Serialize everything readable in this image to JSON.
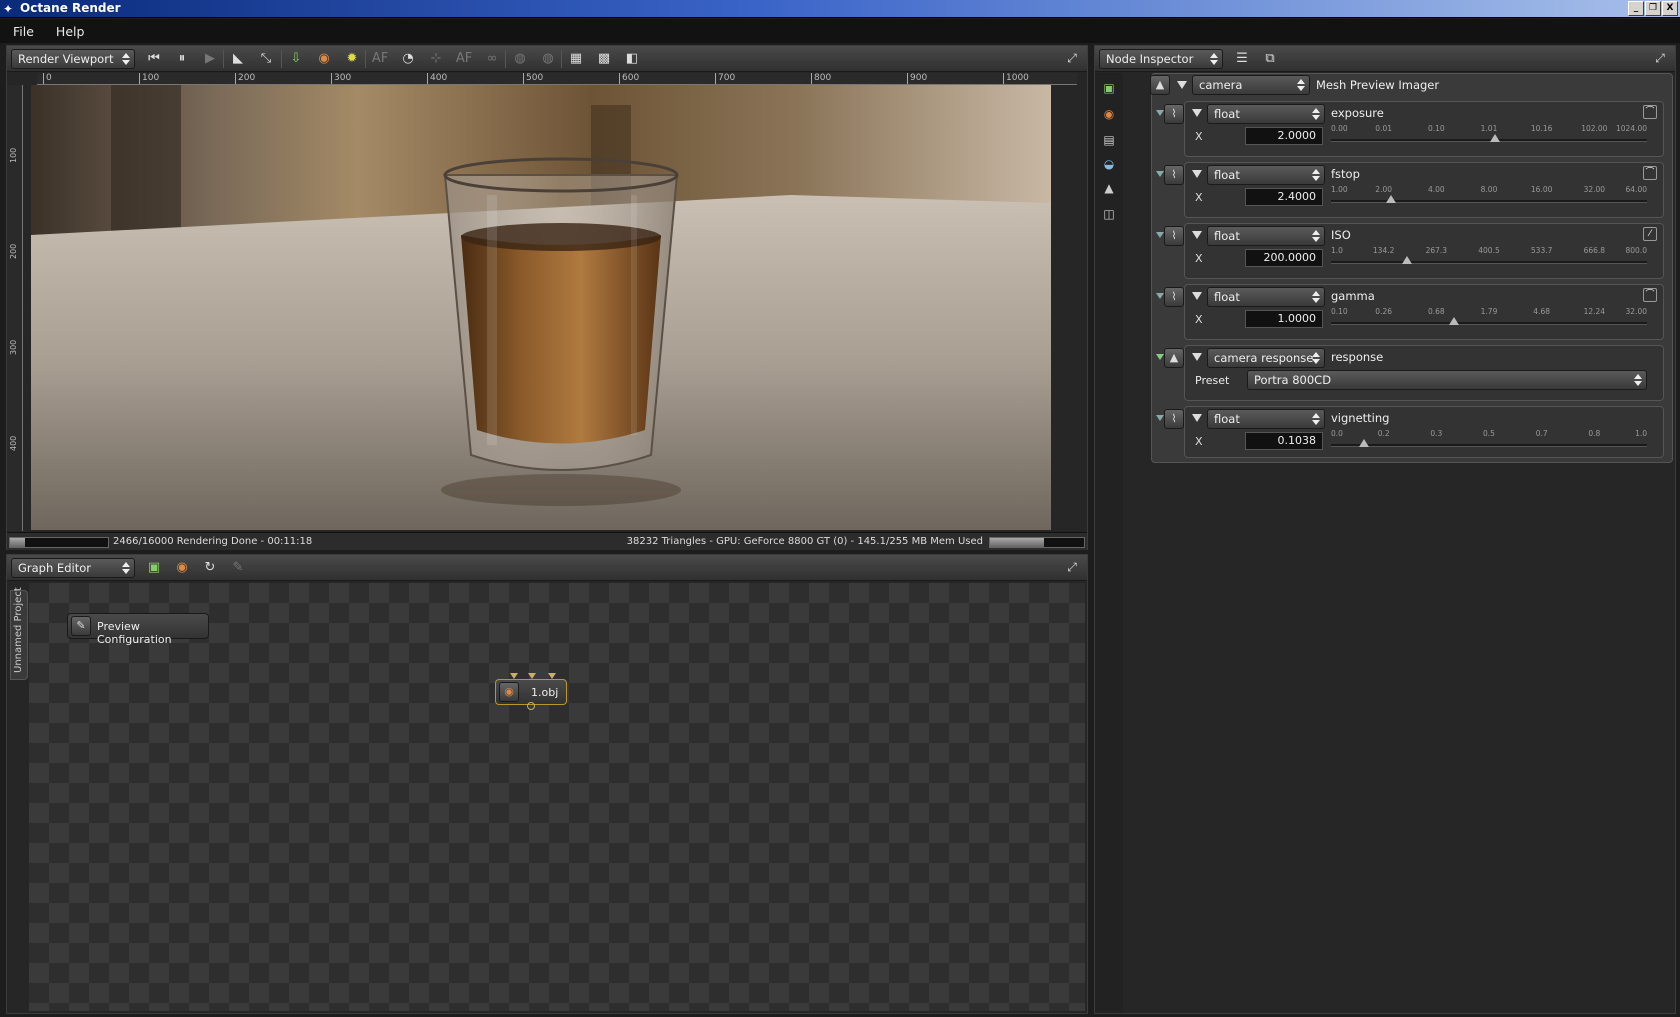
{
  "window": {
    "title": "Octane Render",
    "controls": [
      "_",
      "❐",
      "X"
    ]
  },
  "menu": {
    "file": "File",
    "help": "Help"
  },
  "viewport": {
    "selector": "Render Viewport",
    "ruler_h": [
      "0",
      "100",
      "200",
      "300",
      "400",
      "500",
      "600",
      "700",
      "800",
      "900",
      "1000"
    ],
    "ruler_v": [
      "100",
      "200",
      "300",
      "400"
    ],
    "status_left": "2466/16000 Rendering Done - 00:11:18",
    "status_right": "38232 Triangles - GPU: GeForce 8800 GT (0) - 145.1/255 MB Mem Used",
    "progress": 0.15,
    "mem_usage": 0.57
  },
  "graph": {
    "selector": "Graph Editor",
    "project_tab": "Unnamed Project",
    "node_preview": "Preview Configuration",
    "node_obj": "1.obj"
  },
  "inspector": {
    "selector": "Node Inspector",
    "root_type": "camera",
    "root_name": "Mesh Preview Imager",
    "params": [
      {
        "type": "float",
        "name": "exposure",
        "axis": "X",
        "value": "2.0000",
        "ticks": [
          "0.00",
          "0.01",
          "0.10",
          "1.01",
          "10.16",
          "102.00",
          "1024.00"
        ],
        "knob": 0.52
      },
      {
        "type": "float",
        "name": "fstop",
        "axis": "X",
        "value": "2.4000",
        "ticks": [
          "1.00",
          "2.00",
          "4.00",
          "8.00",
          "16.00",
          "32.00",
          "64.00"
        ],
        "knob": 0.19
      },
      {
        "type": "float",
        "name": "ISO",
        "axis": "X",
        "value": "200.0000",
        "ticks": [
          "1.0",
          "134.2",
          "267.3",
          "400.5",
          "533.7",
          "666.8",
          "800.0"
        ],
        "knob": 0.24
      },
      {
        "type": "float",
        "name": "gamma",
        "axis": "X",
        "value": "1.0000",
        "ticks": [
          "0.10",
          "0.26",
          "0.68",
          "1.79",
          "4.68",
          "12.24",
          "32.00"
        ],
        "knob": 0.39
      },
      {
        "type": "float",
        "name": "vignetting",
        "axis": "X",
        "value": "0.1038",
        "ticks": [
          "0.0",
          "0.2",
          "0.3",
          "0.5",
          "0.7",
          "0.8",
          "1.0"
        ],
        "knob": 0.104
      }
    ],
    "response": {
      "type": "camera response",
      "name": "response",
      "preset_label": "Preset",
      "preset_value": "Portra 800CD"
    }
  }
}
